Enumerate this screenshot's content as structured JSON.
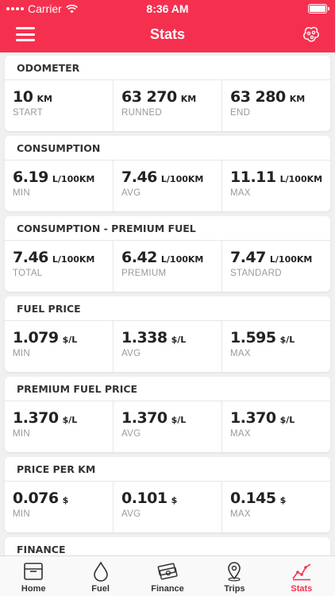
{
  "status_bar": {
    "carrier": "Carrier",
    "time": "8:36 AM"
  },
  "nav": {
    "title": "Stats"
  },
  "cards": [
    {
      "title": "ODOMETER",
      "cells": [
        {
          "value": "10",
          "unit": "KM",
          "label": "START"
        },
        {
          "value": "63 270",
          "unit": "KM",
          "label": "RUNNED"
        },
        {
          "value": "63 280",
          "unit": "KM",
          "label": "END"
        }
      ]
    },
    {
      "title": "CONSUMPTION",
      "cells": [
        {
          "value": "6.19",
          "unit": "L/100KM",
          "label": "MIN"
        },
        {
          "value": "7.46",
          "unit": "L/100KM",
          "label": "AVG"
        },
        {
          "value": "11.11",
          "unit": "L/100KM",
          "label": "MAX"
        }
      ]
    },
    {
      "title": "CONSUMPTION - PREMIUM FUEL",
      "cells": [
        {
          "value": "7.46",
          "unit": "L/100KM",
          "label": "TOTAL"
        },
        {
          "value": "6.42",
          "unit": "L/100KM",
          "label": "PREMIUM"
        },
        {
          "value": "7.47",
          "unit": "L/100KM",
          "label": "STANDARD"
        }
      ]
    },
    {
      "title": "FUEL PRICE",
      "cells": [
        {
          "value": "1.079",
          "unit": "$/L",
          "label": "MIN"
        },
        {
          "value": "1.338",
          "unit": "$/L",
          "label": "AVG"
        },
        {
          "value": "1.595",
          "unit": "$/L",
          "label": "MAX"
        }
      ]
    },
    {
      "title": "PREMIUM FUEL PRICE",
      "cells": [
        {
          "value": "1.370",
          "unit": "$/L",
          "label": "MIN"
        },
        {
          "value": "1.370",
          "unit": "$/L",
          "label": "AVG"
        },
        {
          "value": "1.370",
          "unit": "$/L",
          "label": "MAX"
        }
      ]
    },
    {
      "title": "PRICE PER KM",
      "cells": [
        {
          "value": "0.076",
          "unit": "$",
          "label": "MIN"
        },
        {
          "value": "0.101",
          "unit": "$",
          "label": "AVG"
        },
        {
          "value": "0.145",
          "unit": "$",
          "label": "MAX"
        }
      ]
    }
  ],
  "partial_card_title": "FINANCE",
  "tabs": [
    {
      "label": "Home",
      "icon": "home-icon"
    },
    {
      "label": "Fuel",
      "icon": "fuel-drop-icon"
    },
    {
      "label": "Finance",
      "icon": "money-stack-icon"
    },
    {
      "label": "Trips",
      "icon": "map-pin-icon"
    },
    {
      "label": "Stats",
      "icon": "stats-chart-icon",
      "active": true
    }
  ],
  "colors": {
    "accent": "#f5304f"
  }
}
